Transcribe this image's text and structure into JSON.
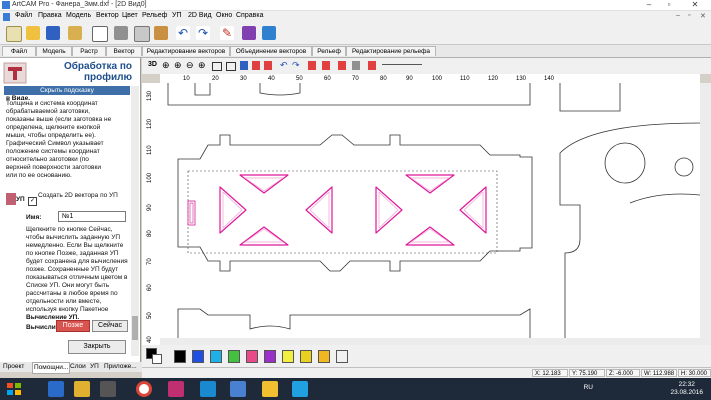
{
  "window": {
    "title": "ArtCAM Pro - Фанера_3мм.dxf - [2D Вид0]"
  },
  "menu": [
    "Файл",
    "Правка",
    "Модель",
    "Вектор",
    "Цвет",
    "Рельеф",
    "УП",
    "2D Вид",
    "Окно",
    "Справка"
  ],
  "tabs": [
    "Файл",
    "Модель",
    "Растр",
    "Вектор",
    "Редактирование векторов",
    "Объединение векторов",
    "Рельеф",
    "Редактирование рельефа"
  ],
  "panel": {
    "title": "Обработка по профилю",
    "hint_toggle": "Скрыть подсказку",
    "hint_cut": "в Виде.",
    "hint_lines": [
      "Толщина и система координат",
      "обрабатываемой заготовки,",
      "показаны выше (если заготовка не",
      "определена, щелкните кнопкой",
      "мыши, чтобы определить ее).",
      "Графический Символ указывает",
      "положение системы координат",
      "относительно заготовки (по",
      "верхней поверхности заготовки",
      "или по ее основанию."
    ],
    "create_vector_label": "Создать 2D вектора по УП",
    "up_label": "УП",
    "name_label": "Имя:",
    "name_value": "№1",
    "info_lines": [
      "Щелкните по кнопке Сейчас,",
      "чтобы вычислить заданную УП",
      "немедленно. Если Вы щелкните",
      "по кнопке Позже, заданная УП",
      "будет сохранена для вычисления",
      "позже. Сохраненные УП будут",
      "показываться отличным цветом в",
      "Списке УП. Они могут быть",
      "рассчитаны в любое время по",
      "отдельности или вместе,",
      "используя кнопку Пакетное",
      "Вычисление УП."
    ],
    "compute_label": "Вычислит",
    "later_button": "Позже",
    "now_button": "Сейчас",
    "close_button": "Закрыть"
  },
  "canvas_toolbar": {
    "view3d": "3D"
  },
  "ruler": {
    "top": [
      "10",
      "20",
      "30",
      "40",
      "50",
      "60",
      "70",
      "80",
      "90",
      "100",
      "110",
      "120",
      "130",
      "140"
    ],
    "left": [
      "130",
      "120",
      "110",
      "100",
      "90",
      "80",
      "70",
      "60",
      "50",
      "40"
    ]
  },
  "palette": {
    "colors": [
      "#000000",
      "#ffffff",
      "#000000",
      "#1f4fe0",
      "#20b0e8",
      "#44c040",
      "#e84a8a",
      "#9b30c8",
      "#f3ef40",
      "#e8d020",
      "#f0b820"
    ]
  },
  "bottom_tabs": [
    "Проект",
    "Помощни...",
    "Слои",
    "УП",
    "Приложе..."
  ],
  "status": {
    "x": "X: 12.183",
    "y": "Y: 75.190",
    "z": "Z: -6.000",
    "w": "W: 112.988",
    "h": "H: 30.000"
  },
  "taskbar": {
    "lang": "RU",
    "time": "22:32",
    "date": "23.08.2016"
  }
}
